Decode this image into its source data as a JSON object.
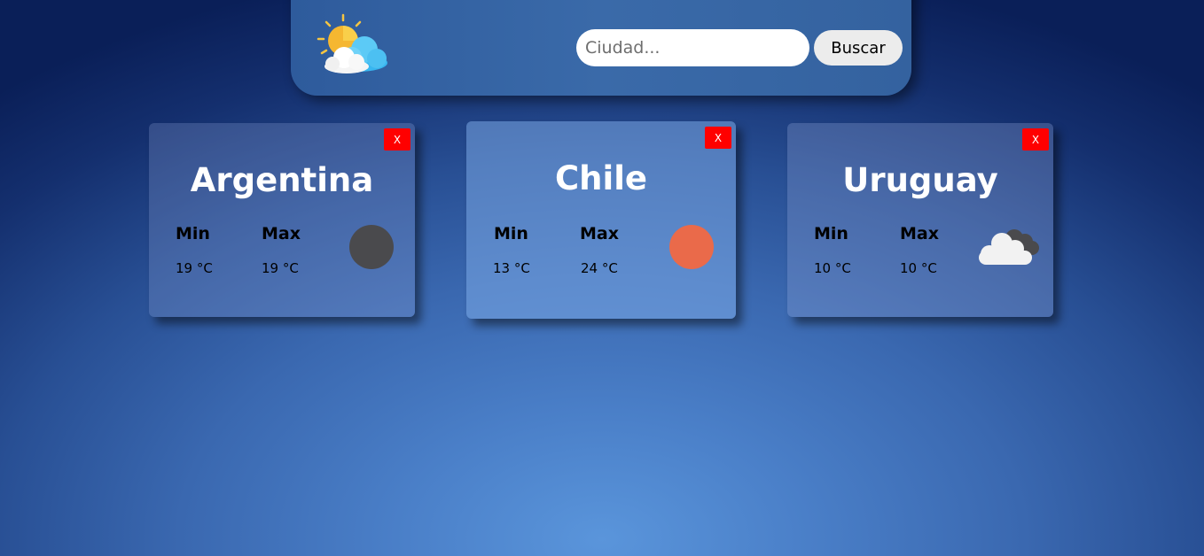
{
  "header": {
    "logo_icon": "sun-behind-cloud-icon",
    "search_placeholder": "Ciudad...",
    "search_value": "",
    "search_button_label": "Buscar"
  },
  "cards": [
    {
      "city": "Argentina",
      "close_label": "X",
      "min_label": "Min",
      "max_label": "Max",
      "min_temp": "19 °C",
      "max_temp": "19 °C",
      "icon": "dark-circle-icon",
      "icon_color": "#4a4a4d"
    },
    {
      "city": "Chile",
      "close_label": "X",
      "min_label": "Min",
      "max_label": "Max",
      "min_temp": "13 °C",
      "max_temp": "24 °C",
      "icon": "orange-sun-icon",
      "icon_color": "#ea6a4a"
    },
    {
      "city": "Uruguay",
      "close_label": "X",
      "min_label": "Min",
      "max_label": "Max",
      "min_temp": "10 °C",
      "max_temp": "10 °C",
      "icon": "clouds-icon",
      "icon_color": "#f2f2f2"
    }
  ],
  "colors": {
    "close_button": "#ff0000",
    "navbar": "#3a6aa9"
  }
}
